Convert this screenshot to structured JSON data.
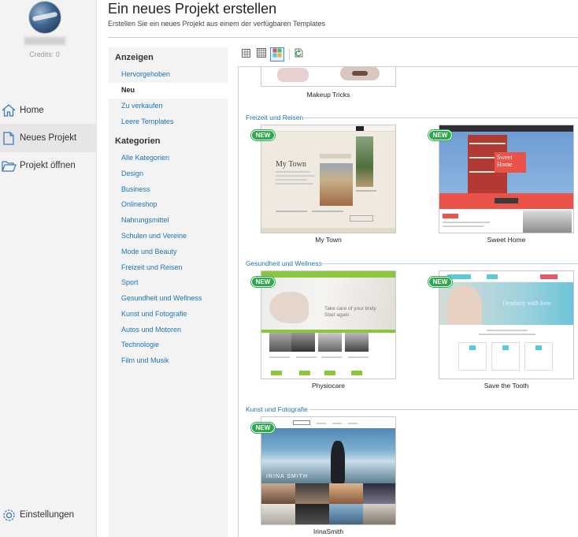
{
  "nav": {
    "credits": "Credits: 0",
    "items": [
      {
        "label": "Home",
        "icon": "home-icon"
      },
      {
        "label": "Neues Projekt",
        "icon": "new-file-icon"
      },
      {
        "label": "Projekt öffnen",
        "icon": "folder-open-icon"
      }
    ],
    "settings_label": "Einstellungen"
  },
  "header": {
    "title": "Ein neues Projekt erstellen",
    "subtitle": "Erstellen Sie ein neues Projekt aus einem der verfügbaren Templates"
  },
  "sidebar": {
    "show_heading": "Anzeigen",
    "show_items": [
      "Hervorgehoben",
      "Neu",
      "Zu verkaufen",
      "Leere Templates"
    ],
    "selected_show": "Neu",
    "categories_heading": "Kategorien",
    "categories": [
      "Alle Kategorien",
      "Design",
      "Business",
      "Onlineshop",
      "Nahrungsmittel",
      "Schulen und Vereine",
      "Mode und Beauty",
      "Freizeit und Reisen",
      "Sport",
      "Gesundheit und Wellness",
      "Kunst und Fotografie",
      "Autos und Motoren",
      "Technologie",
      "Film und Musik"
    ]
  },
  "toolbar": {
    "buttons": [
      "small-grid-view-icon",
      "medium-grid-view-icon",
      "large-grid-view-icon",
      "refresh-icon"
    ],
    "active": "large-grid-view-icon"
  },
  "gallery": {
    "badge": "NEW",
    "top_partial": {
      "name": "Makeup Tricks"
    },
    "sections": [
      {
        "title": "Freizeit und Reisen",
        "templates": [
          {
            "name": "My Town",
            "heading": "My Town"
          },
          {
            "name": "Sweet Home",
            "heading": "Sweet Home"
          }
        ]
      },
      {
        "title": "Gesundheit und Wellness",
        "templates": [
          {
            "name": "Physiocare",
            "heading": "Take care of your body Start again"
          },
          {
            "name": "Save the Tooth",
            "heading": "Dentistry with love"
          }
        ]
      },
      {
        "title": "Kunst und Fotografie",
        "templates": [
          {
            "name": "IrinaSmith",
            "heading": "IRINA SMITH"
          }
        ]
      }
    ]
  },
  "colors": {
    "accent": "#1e74b4",
    "badge": "#2eaa4e",
    "sweet_home_red": "#e9534a",
    "physio_green": "#8cc63f",
    "tooth_teal": "#5ec7d8"
  }
}
